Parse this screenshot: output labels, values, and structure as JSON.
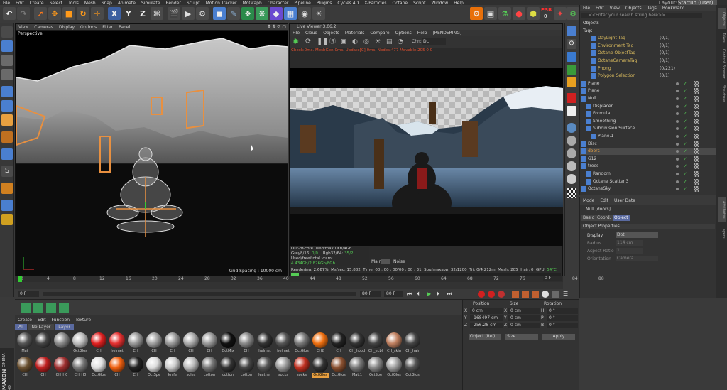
{
  "menubar": [
    "File",
    "Edit",
    "Create",
    "Select",
    "Tools",
    "Mesh",
    "Snap",
    "Animate",
    "Simulate",
    "Render",
    "Sculpt",
    "Motion Tracker",
    "MoGraph",
    "Character",
    "Pipeline",
    "Plugins",
    "Cycles 4D",
    "X-Particles",
    "Octane",
    "Script",
    "Window",
    "Help"
  ],
  "layout_label": "Layout:",
  "layout_value": "Startup (User)",
  "toolbar": {
    "x_label": "X",
    "y_label": "Y",
    "z_label": "Z",
    "psr_label": "PSR",
    "psr_value": "0"
  },
  "viewport": {
    "menu": [
      "View",
      "Cameras",
      "Display",
      "Options",
      "Filter",
      "Panel"
    ],
    "name": "Perspective",
    "grid_spacing": "Grid Spacing : 10000 cm"
  },
  "live_viewer": {
    "title": "Live Viewer 3.06.2",
    "menu": [
      "File",
      "Cloud",
      "Objects",
      "Materials",
      "Compare",
      "Options",
      "Help"
    ],
    "status": "[RENDERING]",
    "chn_label": "Chn:",
    "chn_value": "DL",
    "check_line": "Check:0ms. MeshGen:0ms. Update[C]:0ms. Nodes:477 Movable:205  0 0",
    "stats": [
      {
        "label": "Out-of-core used/max:",
        "value": "0Kb/4Gb"
      },
      {
        "label": "Grey8/16:",
        "value": "0/0",
        "label2": "Rgb32/64:",
        "value2": "35/2"
      },
      {
        "label": "Used/free/total vram:",
        "value": "4.434Gb/2.826Gb/8Gb"
      }
    ],
    "main_label": "Main",
    "noise_label": "Noise",
    "render_line": {
      "rendering": "Rendering: 2.667%",
      "ms": "Ms/sec: 15.882",
      "time": "Time: 00 : 00 : 00/00 : 00 : 31",
      "spp": "Spp/maxspp: 32/1200",
      "tri": "Tri: 0/4.212m",
      "mesh": "Mesh: 205",
      "hair": "Hair: 0",
      "gpu": "GPU:",
      "temp": "54°C"
    }
  },
  "object_manager": {
    "menu": [
      "File",
      "Edit",
      "View",
      "Objects",
      "Tags",
      "Bookmark"
    ],
    "search_placeholder": "<<Enter your search string here>>",
    "rows": [
      {
        "name": "Objects",
        "indent": 0,
        "color": "#ddd"
      },
      {
        "name": "Tags",
        "indent": 0,
        "color": "#ddd"
      },
      {
        "name": "DayLight Tag",
        "indent": 3,
        "color": "#e0c060",
        "val": "(0/1)"
      },
      {
        "name": "Environment Tag",
        "indent": 3,
        "color": "#e0c060",
        "val": "(0/1)"
      },
      {
        "name": "Octane ObjectTag",
        "indent": 3,
        "color": "#e0c060",
        "val": "(0/1)"
      },
      {
        "name": "OctaneCameraTag",
        "indent": 3,
        "color": "#e0c060",
        "val": "(0/1)"
      },
      {
        "name": "Phong",
        "indent": 3,
        "color": "#e0c060",
        "val": "(0/221)"
      },
      {
        "name": "Polygon Selection",
        "indent": 3,
        "color": "#e0c060",
        "val": "(0/1)"
      },
      {
        "name": "Plane",
        "indent": 1,
        "color": "#cfcfcf"
      },
      {
        "name": "Plane",
        "indent": 1,
        "color": "#cfcfcf"
      },
      {
        "name": "Null",
        "indent": 1,
        "color": "#cfcfcf"
      },
      {
        "name": "Displacer",
        "indent": 2,
        "color": "#cfcfcf"
      },
      {
        "name": "Formula",
        "indent": 2,
        "color": "#cfcfcf"
      },
      {
        "name": "Smoothing",
        "indent": 2,
        "color": "#cfcfcf"
      },
      {
        "name": "Subdivision Surface",
        "indent": 2,
        "color": "#cfcfcf"
      },
      {
        "name": "Plane.1",
        "indent": 3,
        "color": "#cfcfcf"
      },
      {
        "name": "Disc",
        "indent": 1,
        "color": "#cfcfcf"
      },
      {
        "name": "doors",
        "indent": 1,
        "color": "#e8a040"
      },
      {
        "name": "G12",
        "indent": 1,
        "color": "#cfcfcf"
      },
      {
        "name": "trees",
        "indent": 1,
        "color": "#cfcfcf"
      },
      {
        "name": "Random",
        "indent": 2,
        "color": "#cfcfcf"
      },
      {
        "name": "Octane Scatter.3",
        "indent": 2,
        "color": "#cfcfcf"
      },
      {
        "name": "OctaneSky",
        "indent": 1,
        "color": "#cfcfcf"
      }
    ]
  },
  "attributes": {
    "menu": [
      "Mode",
      "Edit",
      "User Data"
    ],
    "title": "Null [doors]",
    "tabs": [
      "Basic",
      "Coord.",
      "Object"
    ],
    "section": "Object Properties",
    "display_label": "Display",
    "display_value": "Dot",
    "radius_label": "Radius",
    "radius_value": "114 cm",
    "aspect_label": "Aspect Ratio",
    "aspect_value": "1",
    "orientation_label": "Orientation",
    "orientation_value": "Camera"
  },
  "side_tabs": [
    "Objects",
    "Takes",
    "Content Browser",
    "Structure",
    "Attributes",
    "Layers"
  ],
  "timeline": {
    "ticks": [
      "0",
      "4",
      "8",
      "12",
      "16",
      "20",
      "24",
      "28",
      "32",
      "36",
      "40",
      "44",
      "48",
      "52",
      "56",
      "60",
      "64",
      "68",
      "72",
      "76",
      "80",
      "84",
      "88"
    ],
    "frame_field": "0 F",
    "start_field": "0 F",
    "end_field": "80 F",
    "end2_field": "80 F"
  },
  "material_manager": {
    "menu": [
      "Create",
      "Edit",
      "Function",
      "Texture"
    ],
    "filters": [
      "All",
      "No Layer",
      "Layer"
    ],
    "materials_row1": [
      {
        "label": "Mat",
        "color": "#555"
      },
      {
        "label": "",
        "color": "#444"
      },
      {
        "label": "",
        "color": "#8a8a8a"
      },
      {
        "label": "OctGlos",
        "color": "#bbb"
      },
      {
        "label": "CH",
        "color": "#e02020"
      },
      {
        "label": "helmet",
        "color": "#e53030"
      },
      {
        "label": "CH",
        "color": "#999"
      },
      {
        "label": "CH",
        "color": "#a0a0a0"
      },
      {
        "label": "CH",
        "color": "#999"
      },
      {
        "label": "CH",
        "color": "#aaa"
      },
      {
        "label": "CH",
        "color": "#999"
      },
      {
        "label": "OctMix",
        "color": "#111"
      },
      {
        "label": "CH",
        "color": "#888"
      },
      {
        "label": "helmet",
        "color": "#333"
      },
      {
        "label": "helmet",
        "color": "#555"
      },
      {
        "label": "OctGlos",
        "color": "#777"
      },
      {
        "label": "CH2",
        "color": "#f07010"
      },
      {
        "label": "CH",
        "color": "#222"
      },
      {
        "label": "CH_hood",
        "color": "#333"
      },
      {
        "label": "CH_ecbl",
        "color": "#444"
      },
      {
        "label": "CH_skin",
        "color": "#c08060"
      },
      {
        "label": "CH_hair",
        "color": "#444"
      }
    ],
    "materials_row2": [
      {
        "label": "CH",
        "color": "#6a5030"
      },
      {
        "label": "CH",
        "color": "#c02020"
      },
      {
        "label": "CH_H0",
        "color": "#a03030"
      },
      {
        "label": "CH_H0",
        "color": "#777"
      },
      {
        "label": "OctGlos",
        "color": "#e0e0e0"
      },
      {
        "label": "CH",
        "color": "#f06010"
      },
      {
        "label": "CH",
        "color": "#222"
      },
      {
        "label": "OctSpe",
        "color": "#ddd"
      },
      {
        "label": "knife",
        "color": "#ccc"
      },
      {
        "label": "soles",
        "color": "#bbb"
      },
      {
        "label": "cotton",
        "color": "#777"
      },
      {
        "label": "cotton",
        "color": "#333"
      },
      {
        "label": "cotton",
        "color": "#444"
      },
      {
        "label": "leather",
        "color": "#555"
      },
      {
        "label": "socks",
        "color": "#999"
      },
      {
        "label": "socks",
        "color": "#c03020"
      },
      {
        "label": "OctGlos",
        "color": "#333"
      },
      {
        "label": "OctGlos",
        "color": "#8a5030"
      },
      {
        "label": "Mat.1",
        "color": "#777"
      },
      {
        "label": "OctSpe",
        "color": "#888"
      },
      {
        "label": "OctGlos",
        "color": "#a0a0a0"
      },
      {
        "label": "OctGlos",
        "color": "#555"
      }
    ]
  },
  "coordinates": {
    "headers": [
      "Position",
      "Size",
      "Rotation"
    ],
    "rows": [
      {
        "axis": "X",
        "pos": "0 cm",
        "sz_axis": "X",
        "size": "0 cm",
        "rot_axis": "H",
        "rot": "0 °"
      },
      {
        "axis": "Y",
        "pos": "-168497 cm",
        "sz_axis": "Y",
        "size": "0 cm",
        "rot_axis": "P",
        "rot": "0 °"
      },
      {
        "axis": "Z",
        "pos": "-256.28 cm",
        "sz_axis": "Z",
        "size": "0 cm",
        "rot_axis": "B",
        "rot": "0 °"
      }
    ],
    "mode1": "Object (Rel)",
    "mode2": "Size",
    "apply": "Apply"
  },
  "branding": {
    "line1": "MAXON",
    "line2": "CINEMA 4D"
  },
  "colors": {
    "accent": "#e87a1a",
    "panel": "#333333",
    "selected": "#e8a040"
  }
}
